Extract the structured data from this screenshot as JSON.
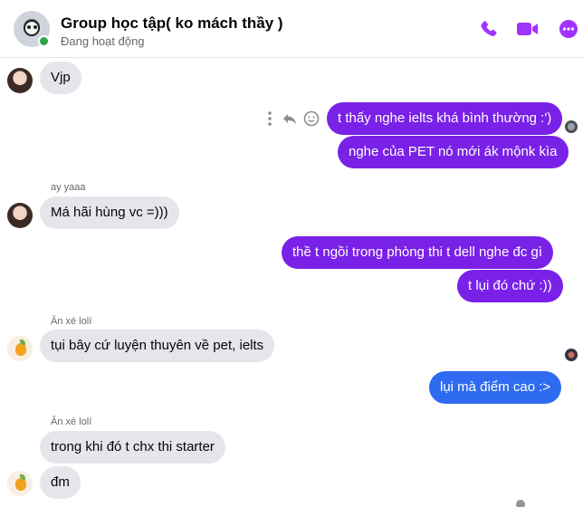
{
  "header": {
    "title": "Group học tập( ko mách thầy )",
    "status": "Đang hoạt động",
    "icons": [
      "phone-icon",
      "video-camera-icon",
      "more-options-icon"
    ],
    "accent_color": "#a033ff"
  },
  "colors": {
    "outgoing_purple": "#7a21e8",
    "outgoing_blue": "#2f6bf0",
    "incoming": "#e4e6eb"
  },
  "messages": [
    {
      "direction": "in",
      "text": "Vjp"
    },
    {
      "direction": "out",
      "text": "t thấy nghe ielts khá bình thường :')"
    },
    {
      "direction": "out",
      "text": "nghe của PET nó mới ák mộnk kìa"
    },
    {
      "direction": "in",
      "sender": "ay yaaa",
      "text": "Má hãi hùng vc =)))"
    },
    {
      "direction": "out",
      "text": "thề t ngồi trong phòng thi t dell nghe đc gì"
    },
    {
      "direction": "out",
      "text": "t lụi đó chứ :))"
    },
    {
      "direction": "in",
      "sender": "Ăn xé lolí",
      "text": "tụi bây cứ luyện thuyên về pet, ielts"
    },
    {
      "direction": "out",
      "text": "lụi mà điểm cao :>"
    },
    {
      "direction": "in",
      "sender": "Ăn xé lolí",
      "text": "trong khi đó t chx thi starter"
    },
    {
      "direction": "in",
      "text": "đm"
    }
  ]
}
